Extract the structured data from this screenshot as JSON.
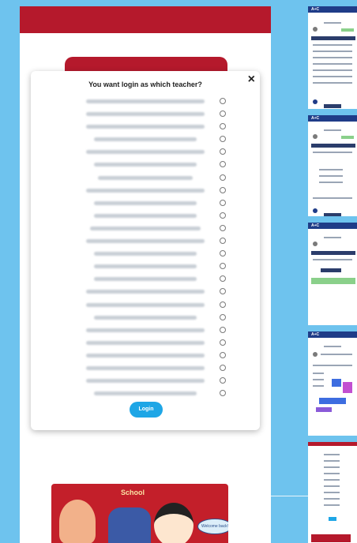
{
  "modal": {
    "title": "You want login as which teacher?",
    "close_label": "×",
    "login_label": "Login",
    "teachers": [
      {
        "w": 150,
        "l": 70
      },
      {
        "w": 150,
        "l": 70
      },
      {
        "w": 150,
        "l": 70
      },
      {
        "w": 130,
        "l": 80
      },
      {
        "w": 150,
        "l": 70
      },
      {
        "w": 130,
        "l": 80
      },
      {
        "w": 120,
        "l": 85
      },
      {
        "w": 150,
        "l": 70
      },
      {
        "w": 130,
        "l": 80
      },
      {
        "w": 130,
        "l": 80
      },
      {
        "w": 140,
        "l": 75
      },
      {
        "w": 150,
        "l": 70
      },
      {
        "w": 130,
        "l": 80
      },
      {
        "w": 130,
        "l": 80
      },
      {
        "w": 130,
        "l": 80
      },
      {
        "w": 150,
        "l": 70
      },
      {
        "w": 150,
        "l": 70
      },
      {
        "w": 130,
        "l": 80
      },
      {
        "w": 150,
        "l": 70
      },
      {
        "w": 150,
        "l": 70
      },
      {
        "w": 150,
        "l": 70
      },
      {
        "w": 150,
        "l": 70
      },
      {
        "w": 150,
        "l": 70
      },
      {
        "w": 130,
        "l": 80
      }
    ]
  },
  "background_page": {
    "cartoon_word": "School"
  },
  "thumbnails": {
    "header_logo": "A+C",
    "bubble_text": "Welcome back!"
  },
  "colors": {
    "brand_red": "#b5192c",
    "login_blue": "#1ea6e6",
    "thumb_navy": "#1f3c88",
    "background_blue": "#6ec3ee"
  }
}
